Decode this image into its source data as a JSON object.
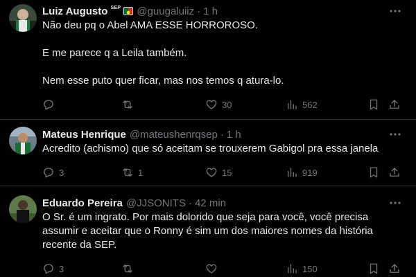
{
  "tweets": [
    {
      "name": "Luiz Augusto",
      "badge": "SEP",
      "handle": "@guugaluiiz",
      "sep": "·",
      "time": "1 h",
      "lines": [
        "Não deu pq o Abel AMA ESSE HORROROSO.",
        "E me parece q a Leila também.",
        "Nem esse puto quer ficar, mas nos temos q atura-lo."
      ],
      "replies": "",
      "retweets": "",
      "likes": "30",
      "views": "562"
    },
    {
      "name": "Mateus Henrique",
      "handle": "@mateushenrqsep",
      "sep": "·",
      "time": "1 h",
      "lines": [
        "Acredito (achismo) que só aceitam se trouxerem Gabigol pra essa janela"
      ],
      "replies": "3",
      "retweets": "1",
      "likes": "15",
      "views": "919"
    },
    {
      "name": "Eduardo Pereira",
      "handle": "@JJSONITS",
      "sep": "·",
      "time": "42 min",
      "lines": [
        "O Sr. é um ingrato. Por mais dolorido que seja para você, você precisa",
        "assumir e aceitar que o Ronny é sim um dos maiores nomes da história",
        "recente da SEP."
      ],
      "replies": "3",
      "retweets": "",
      "likes": "",
      "views": "150"
    }
  ],
  "colors": {
    "background": "#000000",
    "text": "#e7e9ea",
    "secondary": "#71767b",
    "divider": "#2f3336"
  },
  "icons": [
    "reply-icon",
    "retweet-icon",
    "like-icon",
    "views-icon",
    "bookmark-icon",
    "share-icon",
    "more-icon"
  ]
}
